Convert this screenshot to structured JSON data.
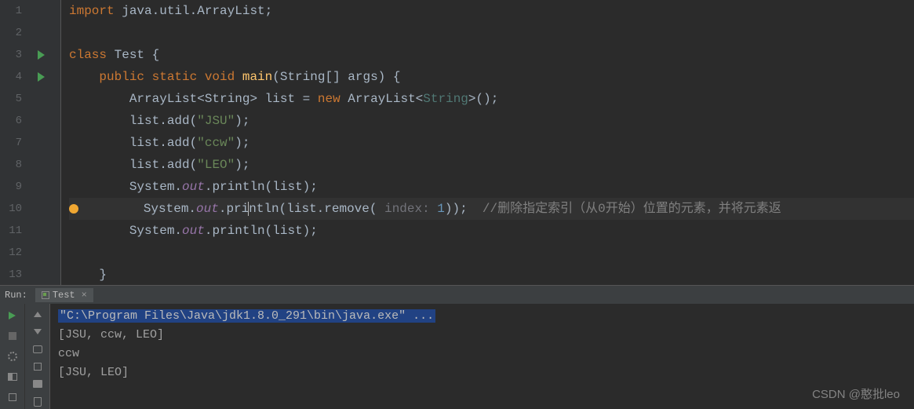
{
  "editor": {
    "lines": [
      {
        "n": 1,
        "tokens": [
          {
            "t": "import ",
            "c": "kw"
          },
          {
            "t": "java.util.ArrayList;",
            "c": "cls"
          }
        ]
      },
      {
        "n": 2,
        "tokens": []
      },
      {
        "n": 3,
        "run": true,
        "fold": true,
        "tokens": [
          {
            "t": "class ",
            "c": "kw"
          },
          {
            "t": "Test ",
            "c": "cls"
          },
          {
            "t": "{",
            "c": "cls"
          }
        ]
      },
      {
        "n": 4,
        "run": true,
        "fold": true,
        "indent": "    ",
        "tokens": [
          {
            "t": "public static void ",
            "c": "kw"
          },
          {
            "t": "main",
            "c": "mtd"
          },
          {
            "t": "(String[] args) {",
            "c": "cls"
          }
        ]
      },
      {
        "n": 5,
        "indent": "        ",
        "tokens": [
          {
            "t": "ArrayList<String> list = ",
            "c": "cls"
          },
          {
            "t": "new ",
            "c": "kw"
          },
          {
            "t": "ArrayList<",
            "c": "cls"
          },
          {
            "t": "String",
            "c": "type"
          },
          {
            "t": ">();",
            "c": "cls"
          }
        ]
      },
      {
        "n": 6,
        "indent": "        ",
        "tokens": [
          {
            "t": "list.add(",
            "c": "cls"
          },
          {
            "t": "\"JSU\"",
            "c": "str"
          },
          {
            "t": ");",
            "c": "cls"
          }
        ]
      },
      {
        "n": 7,
        "indent": "        ",
        "tokens": [
          {
            "t": "list.add(",
            "c": "cls"
          },
          {
            "t": "\"ccw\"",
            "c": "str"
          },
          {
            "t": ");",
            "c": "cls"
          }
        ]
      },
      {
        "n": 8,
        "indent": "        ",
        "tokens": [
          {
            "t": "list.add(",
            "c": "cls"
          },
          {
            "t": "\"LEO\"",
            "c": "str"
          },
          {
            "t": ");",
            "c": "cls"
          }
        ]
      },
      {
        "n": 9,
        "indent": "        ",
        "tokens": [
          {
            "t": "System.",
            "c": "cls"
          },
          {
            "t": "out",
            "c": "fld"
          },
          {
            "t": ".println(list);",
            "c": "cls"
          }
        ]
      },
      {
        "n": 10,
        "bulb": true,
        "current": true,
        "indent": "        ",
        "tokens": [
          {
            "t": "System.",
            "c": "cls"
          },
          {
            "t": "out",
            "c": "fld"
          },
          {
            "t": ".pri",
            "c": "cls"
          },
          {
            "t": "",
            "c": "caret"
          },
          {
            "t": "ntln(list.remove(",
            "c": "cls"
          },
          {
            "t": " index: ",
            "c": "param"
          },
          {
            "t": "1",
            "c": "num"
          },
          {
            "t": "));  ",
            "c": "cls"
          },
          {
            "t": "//删除指定索引（从0开始）位置的元素，并将元素返",
            "c": "cmt"
          }
        ]
      },
      {
        "n": 11,
        "indent": "        ",
        "tokens": [
          {
            "t": "System.",
            "c": "cls"
          },
          {
            "t": "out",
            "c": "fld"
          },
          {
            "t": ".println(list);",
            "c": "cls"
          }
        ]
      },
      {
        "n": 12,
        "tokens": []
      },
      {
        "n": 13,
        "indent": "    ",
        "tokens": [
          {
            "t": "}",
            "c": "cls"
          }
        ]
      }
    ]
  },
  "run": {
    "label": "Run:",
    "tab": "Test",
    "cmd": "\"C:\\Program Files\\Java\\jdk1.8.0_291\\bin\\java.exe\" ...",
    "output": [
      "[JSU, ccw, LEO]",
      "ccw",
      "[JSU, LEO]"
    ]
  },
  "watermark": "CSDN @憨批leo"
}
